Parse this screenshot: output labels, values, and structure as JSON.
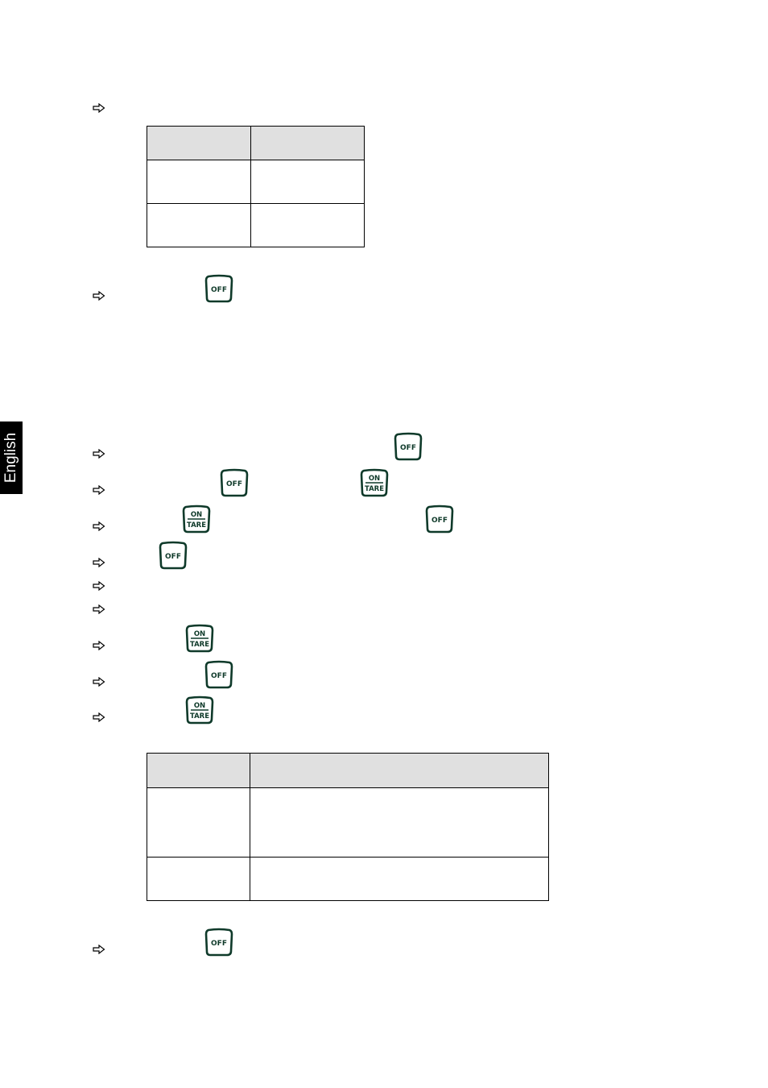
{
  "sidebar_tab": {
    "label": "English"
  },
  "keys": {
    "off": {
      "label": "OFF",
      "icon": "off-key-icon"
    },
    "on_tare": {
      "top": "ON",
      "bottom": "TARE",
      "icon": "on-tare-key-icon"
    }
  },
  "colors": {
    "key_outline": "#0f3a2a",
    "table_header_bg": "#e0e0e0",
    "tab_bg": "#000000"
  },
  "table1": {
    "header": [
      "",
      ""
    ],
    "rows": [
      [
        "",
        ""
      ],
      [
        "",
        ""
      ]
    ]
  },
  "table2": {
    "header": [
      "",
      ""
    ],
    "rows": [
      [
        "",
        ""
      ],
      [
        "",
        ""
      ]
    ]
  }
}
